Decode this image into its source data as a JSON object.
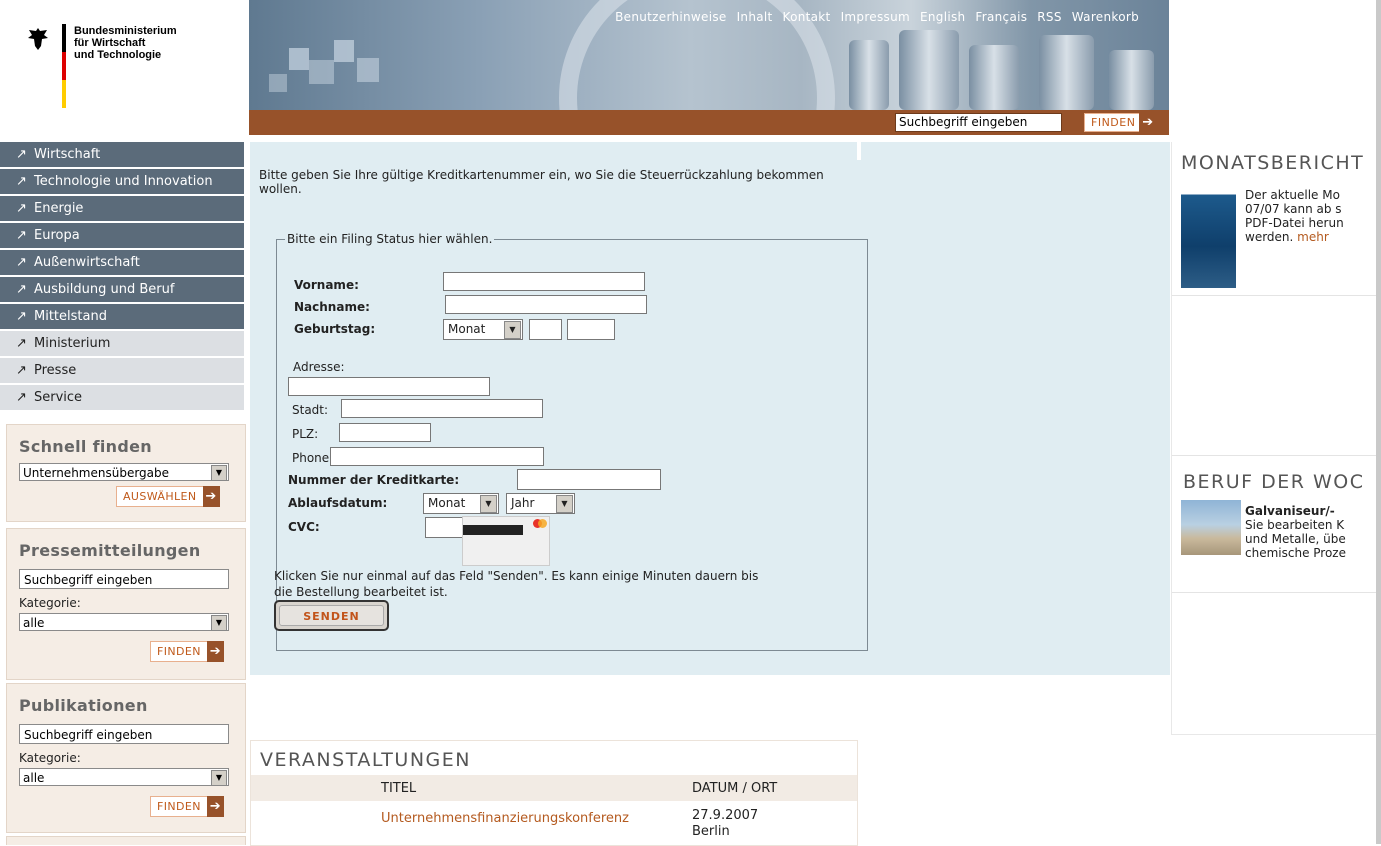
{
  "logo": {
    "line1": "Bundesministerium",
    "line2": "für Wirtschaft",
    "line3": "und Technologie",
    "flag_colors": [
      "#000000",
      "#dd0000",
      "#ffcc00"
    ]
  },
  "topnav": [
    "Benutzerhinweise",
    "Inhalt",
    "Kontakt",
    "Impressum",
    "English",
    "Français",
    "RSS",
    "Warenkorb"
  ],
  "header_search": {
    "placeholder": "Suchbegriff eingeben",
    "button": "FINDEN"
  },
  "leftnav": [
    {
      "label": "Wirtschaft",
      "style": "dark"
    },
    {
      "label": "Technologie und Innovation",
      "style": "dark"
    },
    {
      "label": "Energie",
      "style": "dark"
    },
    {
      "label": "Europa",
      "style": "dark"
    },
    {
      "label": "Außenwirtschaft",
      "style": "dark"
    },
    {
      "label": "Ausbildung und Beruf",
      "style": "dark"
    },
    {
      "label": "Mittelstand",
      "style": "dark"
    },
    {
      "label": "Ministerium",
      "style": "light"
    },
    {
      "label": "Presse",
      "style": "light"
    },
    {
      "label": "Service",
      "style": "light"
    }
  ],
  "schnell": {
    "title": "Schnell finden",
    "select": "Unternehmensübergabe",
    "button": "AUSWÄHLEN"
  },
  "presse": {
    "title": "Pressemitteilungen",
    "search": "Suchbegriff eingeben",
    "kategorie_label": "Kategorie:",
    "kategorie": "alle",
    "button": "FINDEN"
  },
  "publikationen": {
    "title": "Publikationen",
    "search": "Suchbegriff eingeben",
    "kategorie_label": "Kategorie:",
    "kategorie": "alle",
    "button": "FINDEN"
  },
  "form": {
    "intro": "Bitte geben Sie Ihre gültige Kreditkartenummer ein, wo Sie die Steuerrückzahlung bekommen wollen.",
    "legend": "Bitte ein Filing Status hier wählen.",
    "vorname": "Vorname:",
    "nachname": "Nachname:",
    "geburtstag": "Geburtstag:",
    "monat": "Monat",
    "adresse": "Adresse:",
    "stadt": "Stadt:",
    "plz": "PLZ:",
    "phone": "Phone:",
    "kreditkarte": "Nummer der Kreditkarte:",
    "ablaufdatum": "Ablaufsdatum:",
    "ablauf_monat": "Monat",
    "ablauf_jahr": "Jahr",
    "cvc": "CVC:",
    "hinweis_line1": "Klicken Sie nur einmal auf das Feld \"Senden\". Es kann einige Minuten dauern bis",
    "hinweis_line2": "die Bestellung bearbeitet ist.",
    "senden": "SENDEN"
  },
  "events": {
    "title": "VERANSTALTUNGEN",
    "col_title": "TITEL",
    "col_date": "DATUM / ORT",
    "rows": [
      {
        "title": "Unternehmensfinanzierungskonferenz",
        "date": "27.9.2007",
        "place": "Berlin"
      }
    ]
  },
  "right": {
    "monat_title": "MONATSBERICHT",
    "monat_lines": [
      "Der aktuelle Mo",
      "07/07 kann ab s",
      "PDF-Datei herun",
      "werden."
    ],
    "monat_link": "mehr",
    "beruf_title": "BERUF DER WOC",
    "beruf_head": "Galvaniseur/-",
    "beruf_lines": [
      "Sie bearbeiten K",
      "und Metalle, übe",
      "chemische Proze"
    ]
  },
  "colors": {
    "accent_brown": "#97522a",
    "link_orange": "#b45a1f",
    "nav_dark": "#5b6b7a",
    "form_bg": "#e0edf2"
  }
}
